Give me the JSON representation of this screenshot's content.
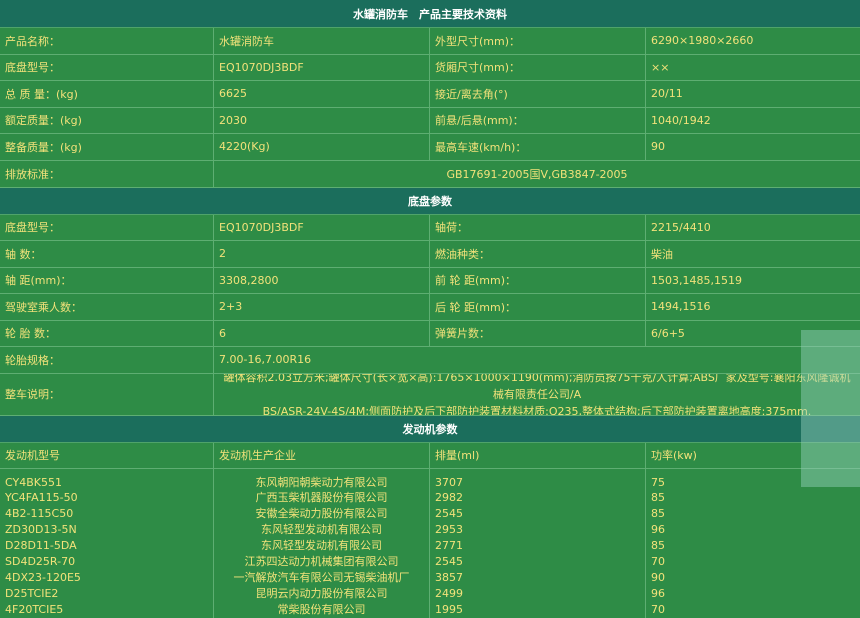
{
  "main_title": "水罐消防车　产品主要技术资料",
  "product_rows": [
    {
      "l1": "产品名称：",
      "v1": "水罐消防车",
      "l2": "外型尺寸(mm)：",
      "v2": "6290×1980×2660"
    },
    {
      "l1": "底盘型号：",
      "v1": "EQ1070DJ3BDF",
      "l2": "货厢尺寸(mm)：",
      "v2": "××"
    },
    {
      "l1": "总 质 量：(kg)",
      "v1": "6625",
      "l2": "接近/离去角(°)",
      "v2": "20/11"
    },
    {
      "l1": "额定质量：(kg)",
      "v1": "2030",
      "l2": "前悬/后悬(mm)：",
      "v2": "1040/1942"
    },
    {
      "l1": "整备质量：(kg)",
      "v1": "4220(Kg)",
      "l2": "最高车速(km/h)：",
      "v2": "90"
    }
  ],
  "emission": {
    "label": "排放标准：",
    "value": "GB17691-2005国V,GB3847-2005"
  },
  "chassis_title": "底盘参数",
  "chassis_rows": [
    {
      "l1": "底盘型号：",
      "v1": "EQ1070DJ3BDF",
      "l2": "轴荷：",
      "v2": "2215/4410"
    },
    {
      "l1": "轴 数：",
      "v1": "2",
      "l2": "燃油种类：",
      "v2": "柴油"
    },
    {
      "l1": "轴 距(mm)：",
      "v1": "3308,2800",
      "l2": "前 轮 距(mm)：",
      "v2": "1503,1485,1519"
    },
    {
      "l1": "驾驶室乘人数：",
      "v1": "2+3",
      "l2": "后 轮 距(mm)：",
      "v2": "1494,1516"
    },
    {
      "l1": "轮 胎 数：",
      "v1": "6",
      "l2": "弹簧片数：",
      "v2": "6/6+5"
    }
  ],
  "tire": {
    "label": "轮胎规格：",
    "value": "7.00-16,7.00R16"
  },
  "vehicle_note": {
    "label": "整车说明：",
    "line1": "罐体容积2.03立方米;罐体尺寸(长×宽×高):1765×1000×1190(mm);消防员按75千克/人计算;ABS厂家及型号:襄阳东风隆诚机械有限责任公司/A",
    "line2": "BS/ASR-24V-4S/4M;侧面防护及后下部防护装置材料材质:Q235,整体式结构;后下部防护装置离地高度:375mm."
  },
  "engine_title": "发动机参数",
  "engine_headers": [
    "发动机型号",
    "发动机生产企业",
    "排量(ml)",
    "功率(kw)"
  ],
  "engines": [
    {
      "model": "CY4BK551",
      "maker": "东风朝阳朝柴动力有限公司",
      "disp": "3707",
      "power": "75"
    },
    {
      "model": "YC4FA115-50",
      "maker": "广西玉柴机器股份有限公司",
      "disp": "2982",
      "power": "85"
    },
    {
      "model": "4B2-115C50",
      "maker": "安徽全柴动力股份有限公司",
      "disp": "2545",
      "power": "85"
    },
    {
      "model": "ZD30D13-5N",
      "maker": "东风轻型发动机有限公司",
      "disp": "2953",
      "power": "96"
    },
    {
      "model": "D28D11-5DA",
      "maker": "东风轻型发动机有限公司",
      "disp": "2771",
      "power": "85"
    },
    {
      "model": "SD4D25R-70",
      "maker": "江苏四达动力机械集团有限公司",
      "disp": "2545",
      "power": "70"
    },
    {
      "model": "4DX23-120E5",
      "maker": "一汽解放汽车有限公司无锡柴油机厂",
      "disp": "3857",
      "power": "90"
    },
    {
      "model": "D25TCIE2",
      "maker": "昆明云内动力股份有限公司",
      "disp": "2499",
      "power": "96"
    },
    {
      "model": "4F20TCIE5",
      "maker": "常柴股份有限公司",
      "disp": "1995",
      "power": "70"
    }
  ]
}
